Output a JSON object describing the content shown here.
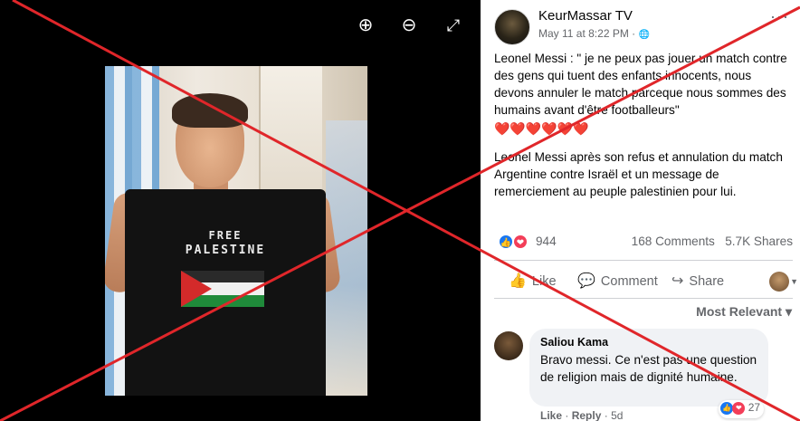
{
  "media": {
    "shirt_line1": "FREE",
    "shirt_line2": "PALESTINE",
    "zoom_in_icon": "⊕",
    "zoom_out_icon": "⊖",
    "fullscreen_icon": "⤢"
  },
  "post": {
    "page_name": "KeurMassar TV",
    "date": "May 11 at 8:22 PM",
    "privacy_icon": "🌐",
    "more_icon": "···",
    "text_p1": "Leonel Messi : \" je ne peux pas jouer un match contre des gens qui tuent des enfants innocents, nous devons annuler le match parceque nous sommes des humains avant d'être footballeurs\"",
    "hearts": "❤️❤️❤️❤️❤️❤️",
    "text_p2": "Leonel Messi après son refus et annulation du match Argentine contre Israël et un message de remerciement au peuple palestinien pour lui.",
    "reactions_count": "944",
    "comments_count": "168 Comments",
    "shares_count": "5.7K Shares"
  },
  "actions": {
    "like": "Like",
    "comment": "Comment",
    "share": "Share"
  },
  "comments": {
    "sort_label": "Most Relevant ▾",
    "items": [
      {
        "author": "Saliou Kama",
        "text": "Bravo messi. Ce n'est pas une question de religion mais de dignité humaine.",
        "reaction_count": "27",
        "like_label": "Like",
        "reply_label": "Reply",
        "age": "5d"
      }
    ]
  },
  "colors": {
    "facebook_blue": "#1877f2",
    "love_red": "#f33e58",
    "x_overlay_red": "#e0262a",
    "muted_text": "#65676b"
  }
}
